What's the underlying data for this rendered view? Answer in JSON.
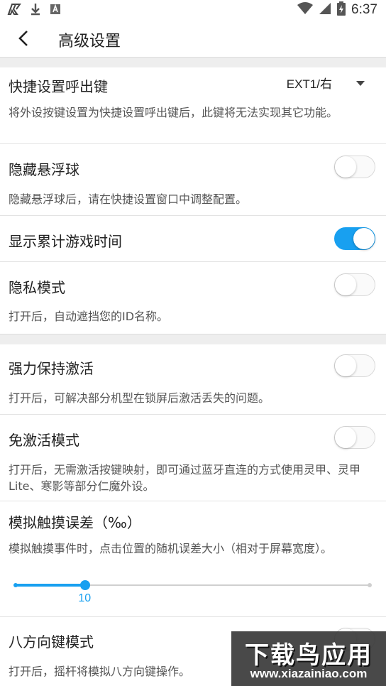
{
  "status_bar": {
    "time": "6:37",
    "icons": [
      "app-logo-icon",
      "download-icon",
      "a-box-icon",
      "wifi-icon",
      "signal-icon",
      "battery-icon"
    ]
  },
  "header": {
    "title": "高级设置"
  },
  "settings": {
    "quick_key": {
      "label": "快捷设置呼出键",
      "value": "EXT1/右",
      "desc": "将外设按键设置为快捷设置呼出键后，此键将无法实现其它功能。"
    },
    "hide_ball": {
      "label": "隐藏悬浮球",
      "desc": "隐藏悬浮球后，请在快捷设置窗口中调整配置。",
      "on": false
    },
    "show_time": {
      "label": "显示累计游戏时间",
      "on": true
    },
    "privacy": {
      "label": "隐私模式",
      "desc": "打开后，自动遮挡您的ID名称。",
      "on": false
    },
    "keep_active": {
      "label": "强力保持激活",
      "desc": "打开后，可解决部分机型在锁屏后激活丢失的问题。",
      "on": false
    },
    "no_activation": {
      "label": "免激活模式",
      "desc": "打开后，无需激活按键映射，即可通过蓝牙直连的方式使用灵甲、灵甲Lite、寒影等部分仁魔外设。",
      "on": false
    },
    "touch_error": {
      "label": "模拟触摸误差（‰）",
      "desc": "模拟触摸事件时，点击位置的随机误差大小（相对于屏幕宽度）。",
      "value": "10",
      "fraction": 0.2
    },
    "eight_dir": {
      "label": "八方向键模式",
      "desc": "打开后，摇杆将模拟八方向键操作。",
      "on": false
    }
  },
  "watermark": {
    "main": "下载鸟应用",
    "url": "www.xiazainiao.com"
  },
  "colors": {
    "accent": "#18a0f0",
    "band": "#eeeeee"
  }
}
